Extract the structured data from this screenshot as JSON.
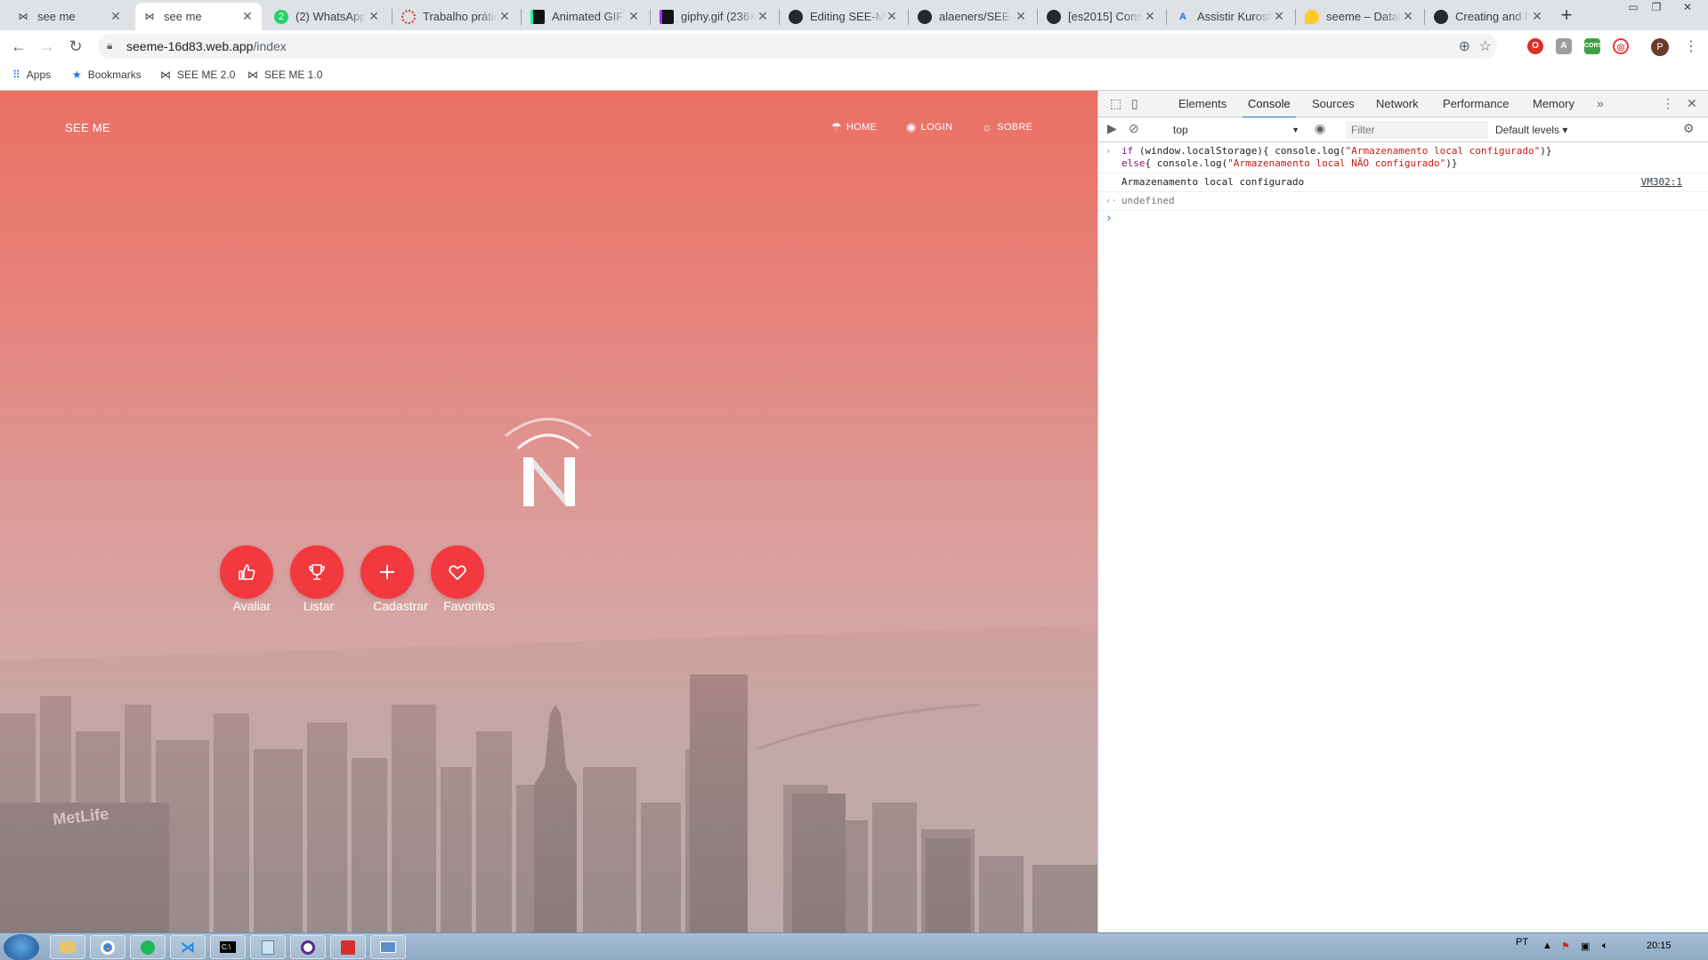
{
  "browser": {
    "tabs": [
      {
        "title": "see me",
        "icon": "bowtie-icon",
        "active": false
      },
      {
        "title": "see me",
        "icon": "bowtie-icon",
        "active": true
      },
      {
        "title": "(2) WhatsApp",
        "icon": "whatsapp-icon",
        "active": false
      },
      {
        "title": "Trabalho prátic",
        "icon": "loading-icon",
        "active": false
      },
      {
        "title": "Animated GIF -",
        "icon": "giphy-icon",
        "active": false
      },
      {
        "title": "giphy.gif (236×",
        "icon": "giphy-icon",
        "active": false
      },
      {
        "title": "Editing SEE-ME",
        "icon": "github-icon",
        "active": false
      },
      {
        "title": "alaeners/SEE-M",
        "icon": "github-icon",
        "active": false
      },
      {
        "title": "[es2015] Const",
        "icon": "github-icon",
        "active": false
      },
      {
        "title": "Assistir Kurosh",
        "icon": "generic-icon",
        "active": false
      },
      {
        "title": "seeme – Datab",
        "icon": "firebase-icon",
        "active": false
      },
      {
        "title": "Creating and h",
        "icon": "github-icon",
        "active": false
      }
    ],
    "url_host": "seeme-16d83.web.app",
    "url_path": "/index",
    "bookmarks": [
      {
        "label": "Apps",
        "icon": "apps-grid-icon"
      },
      {
        "label": "Bookmarks",
        "icon": "star-icon"
      },
      {
        "label": "SEE ME 2.0",
        "icon": "bowtie-icon"
      },
      {
        "label": "SEE ME 1.0",
        "icon": "bowtie-icon"
      }
    ],
    "profile_initial": "P"
  },
  "page": {
    "brand": "SEE ME",
    "nav": [
      {
        "label": "HOME",
        "icon": "umbrella-icon"
      },
      {
        "label": "LOGIN",
        "icon": "user-circle-icon"
      },
      {
        "label": "SOBRE",
        "icon": "bulb-icon"
      }
    ],
    "actions": [
      {
        "label": "Avaliar",
        "icon": "thumbs-up-icon"
      },
      {
        "label": "Listar",
        "icon": "trophy-icon"
      },
      {
        "label": "Cadastrar",
        "icon": "plus-icon"
      },
      {
        "label": "Favoritos",
        "icon": "heart-icon"
      }
    ],
    "accent": "#f2393f"
  },
  "devtools": {
    "tabs": [
      "Elements",
      "Console",
      "Sources",
      "Network",
      "Performance",
      "Memory"
    ],
    "active_tab": "Console",
    "context": "top",
    "filter_placeholder": "Filter",
    "levels": "Default levels",
    "input_line1_kw": "if",
    "input_line1_code": " (window.localStorage){ console.log(",
    "input_line1_str": "\"Armazenamento local configurado\"",
    "input_line1_end": ")}",
    "input_line2_kw": "else",
    "input_line2_code": "{ console.log(",
    "input_line2_str": "\"Armazenamento local NÃO configurado\"",
    "input_line2_end": ")}",
    "log_output": "Armazenamento local configurado",
    "log_source": "VM302:1",
    "return_value": "undefined"
  },
  "taskbar": {
    "language": "PT",
    "time": "20:15"
  }
}
